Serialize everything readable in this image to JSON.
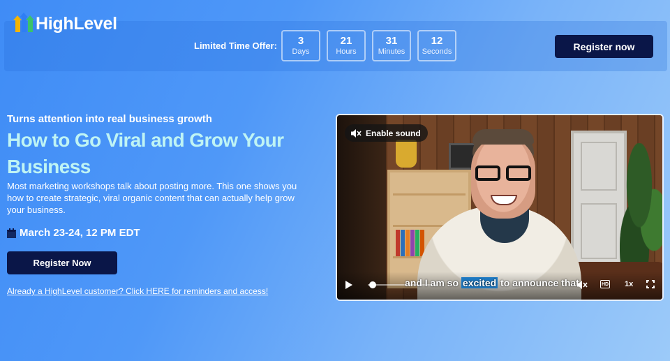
{
  "brand": {
    "name": "HighLevel"
  },
  "header": {
    "offer_label": "Limited Time Offer:",
    "countdown": [
      {
        "value": "3",
        "unit": "Days"
      },
      {
        "value": "21",
        "unit": "Hours"
      },
      {
        "value": "31",
        "unit": "Minutes"
      },
      {
        "value": "12",
        "unit": "Seconds"
      }
    ],
    "register_label": "Register now"
  },
  "hero": {
    "tagline": "Turns attention into real business growth",
    "headline": "How to Go Viral and Grow Your Business",
    "description": "Most marketing workshops talk about posting more. This one shows you how to create strategic, viral organic content that can actually help grow your business.",
    "date": "March 23-24, 12 PM EDT",
    "register_label": "Register Now",
    "customer_link": "Already a HighLevel customer? Click HERE for reminders and access!"
  },
  "video": {
    "enable_sound_label": "Enable sound",
    "caption_before": "and I am so ",
    "caption_highlight": "excited",
    "caption_after": " to announce that",
    "quality_badge": "HD",
    "speed": "1x",
    "progress": 0.02
  },
  "colors": {
    "button_navy": "#0a1648",
    "headline_cyan": "#bff4f4",
    "caption_highlight": "#1d78c1"
  },
  "icons": {
    "calendar": "calendar-icon",
    "mute": "mute-icon",
    "play": "play-icon",
    "fullscreen": "fullscreen-icon"
  }
}
